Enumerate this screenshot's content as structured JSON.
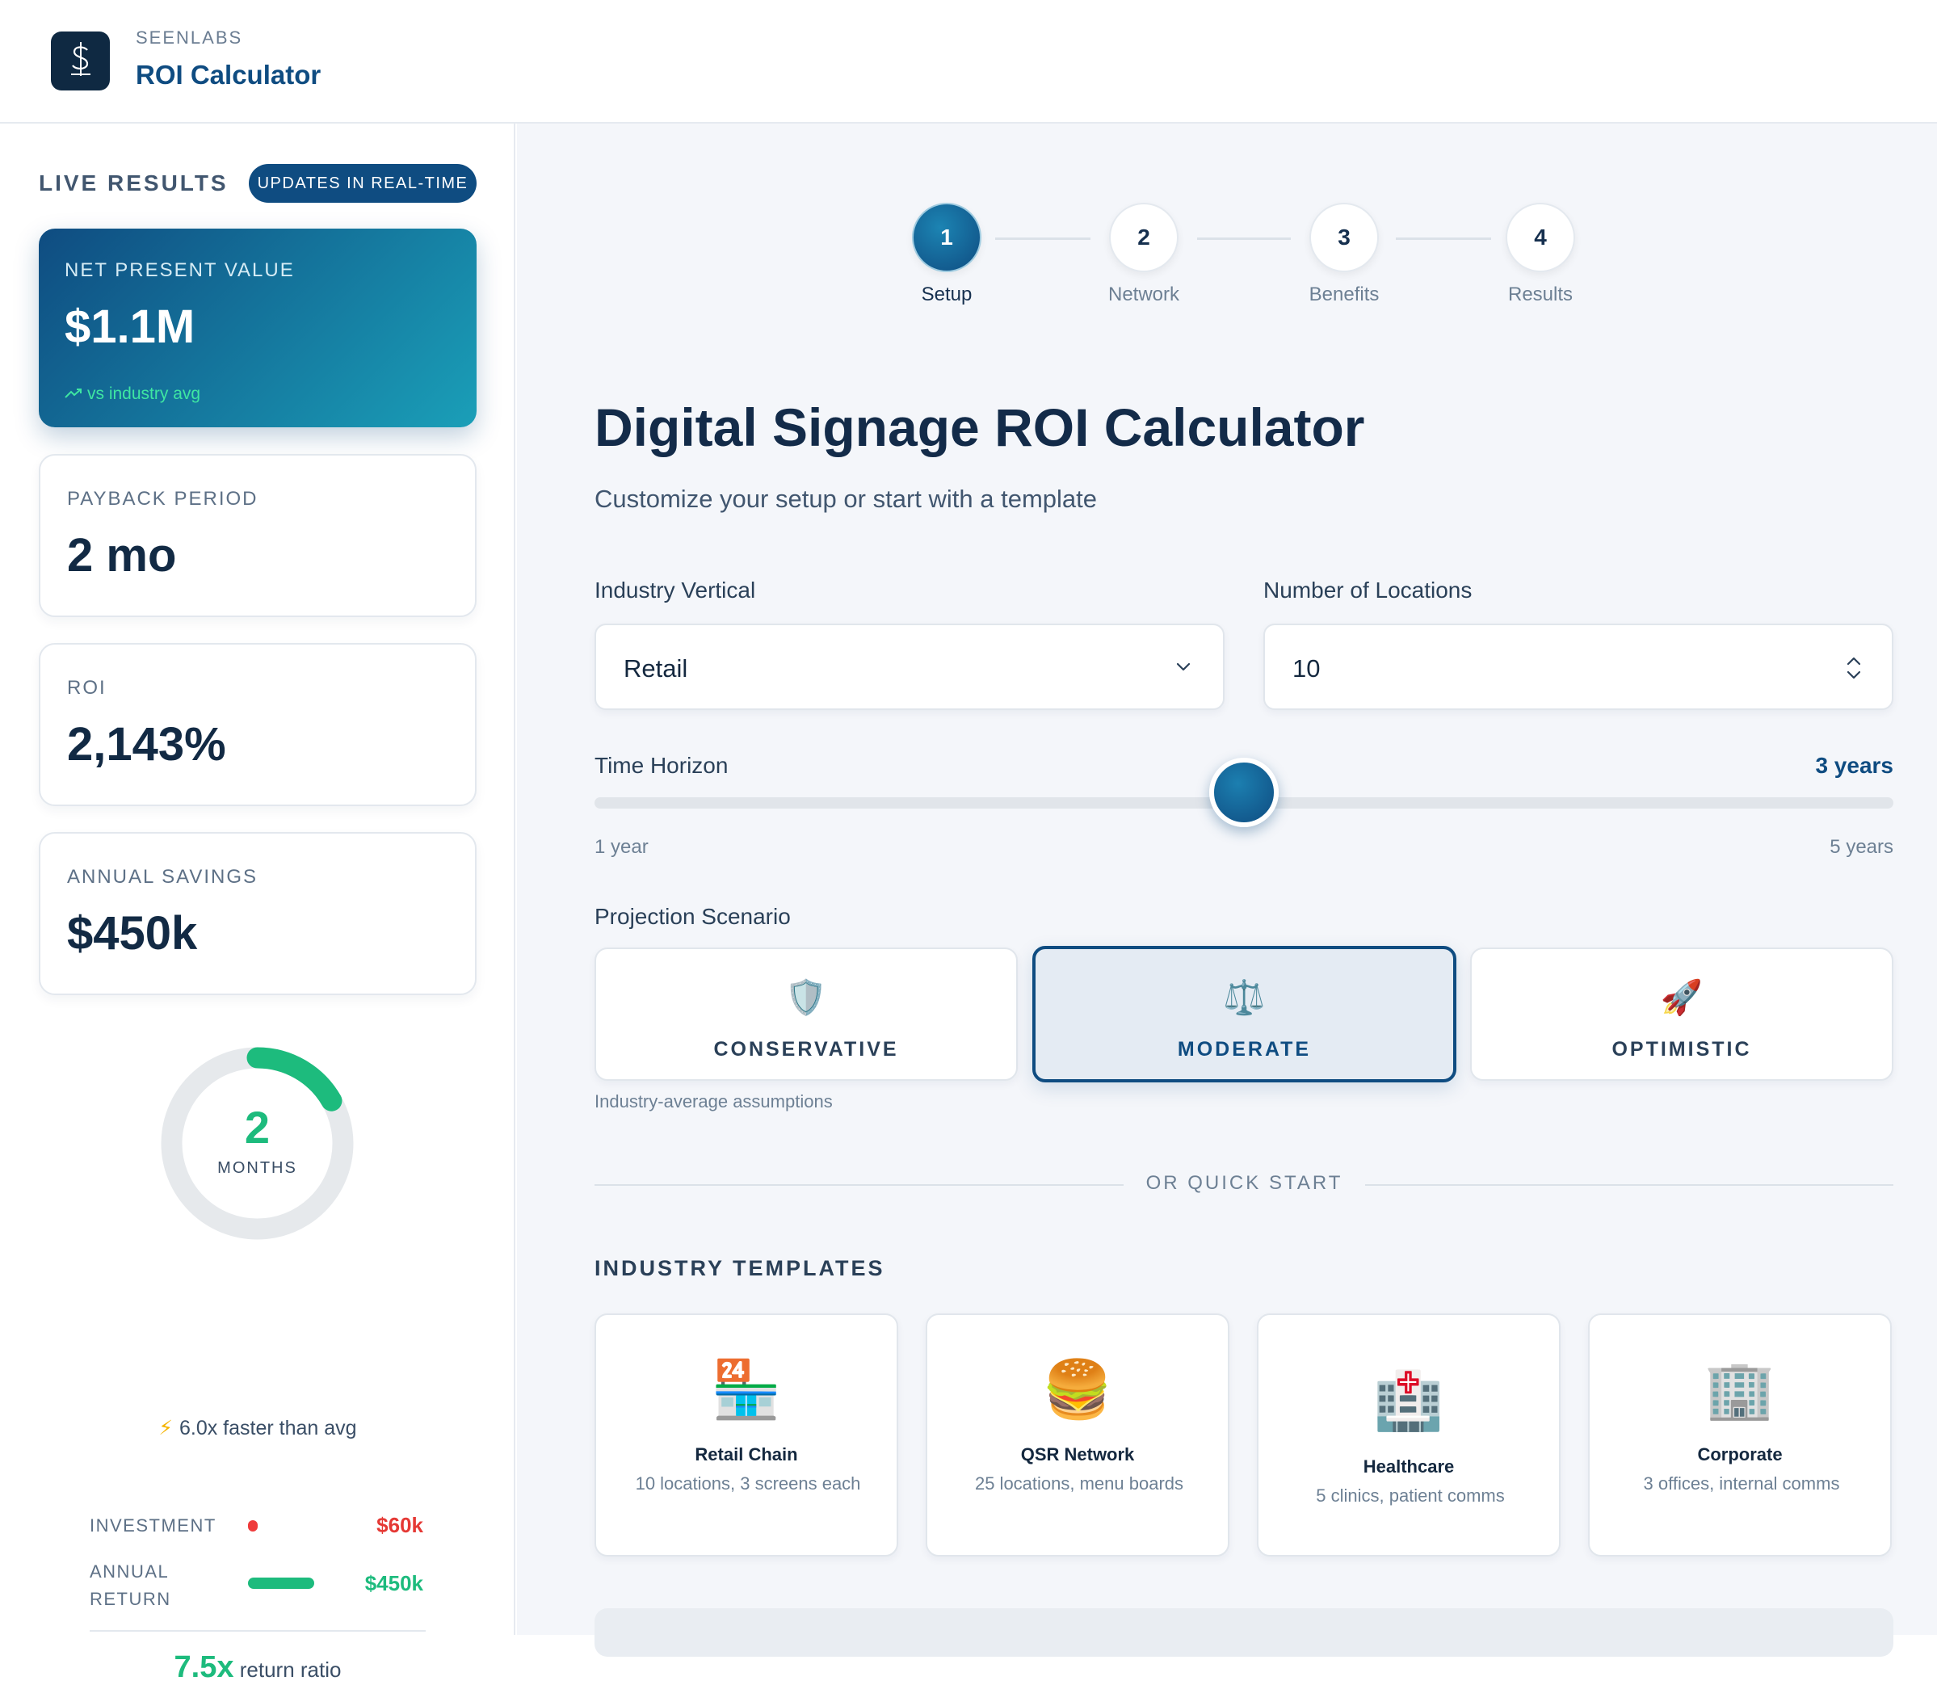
{
  "header": {
    "brand_small": "SEENLABS",
    "brand_title": "ROI Calculator",
    "logo_icon": "dollar-sign-icon"
  },
  "sidebar": {
    "title": "LIVE RESULTS",
    "badge": "UPDATES IN REAL-TIME",
    "npv": {
      "label": "NET PRESENT VALUE",
      "value": "$1.1M",
      "sub": "vs industry avg"
    },
    "payback": {
      "label": "PAYBACK PERIOD",
      "value": "2 mo"
    },
    "roi": {
      "label": "ROI",
      "value": "2,143%"
    },
    "savings": {
      "label": "ANNUAL SAVINGS",
      "value": "$450k"
    },
    "donut": {
      "value": "2",
      "label": "MONTHS",
      "fraction": 0.167
    },
    "faster": "6.0x faster than avg",
    "investment": {
      "label": "INVESTMENT",
      "value": "$60k"
    },
    "annual_return": {
      "label": "ANNUAL RETURN",
      "value": "$450k"
    },
    "ratio": {
      "value": "7.5x",
      "label": "return ratio"
    }
  },
  "steps": [
    {
      "num": "1",
      "label": "Setup",
      "active": true
    },
    {
      "num": "2",
      "label": "Network",
      "active": false
    },
    {
      "num": "3",
      "label": "Benefits",
      "active": false
    },
    {
      "num": "4",
      "label": "Results",
      "active": false
    }
  ],
  "main": {
    "title": "Digital Signage ROI Calculator",
    "subtitle": "Customize your setup or start with a template",
    "industry": {
      "label": "Industry Vertical",
      "value": "Retail"
    },
    "locations": {
      "label": "Number of Locations",
      "value": "10"
    },
    "time_horizon": {
      "label": "Time Horizon",
      "value": "3 years",
      "min_label": "1 year",
      "max_label": "5 years",
      "level": 0.5
    },
    "projection": {
      "label": "Projection Scenario",
      "options": [
        {
          "icon": "🛡️",
          "name": "CONSERVATIVE",
          "selected": false
        },
        {
          "icon": "⚖️",
          "name": "MODERATE",
          "selected": true
        },
        {
          "icon": "🚀",
          "name": "OPTIMISTIC",
          "selected": false
        }
      ],
      "note": "Industry-average assumptions"
    },
    "quick_start": "OR QUICK START",
    "templates_title": "INDUSTRY TEMPLATES",
    "templates": [
      {
        "icon": "🏪",
        "name": "Retail Chain",
        "desc": "10 locations, 3 screens each"
      },
      {
        "icon": "🍔",
        "name": "QSR Network",
        "desc": "25 locations, menu boards"
      },
      {
        "icon": "🏥",
        "name": "Healthcare",
        "desc": "5 clinics, patient comms"
      },
      {
        "icon": "🏢",
        "name": "Corporate",
        "desc": "3 offices, internal comms"
      }
    ]
  },
  "colors": {
    "primary": "#0f4c81",
    "accent": "#1a9fb8",
    "success": "#1dbb7d",
    "danger": "#e53935"
  }
}
